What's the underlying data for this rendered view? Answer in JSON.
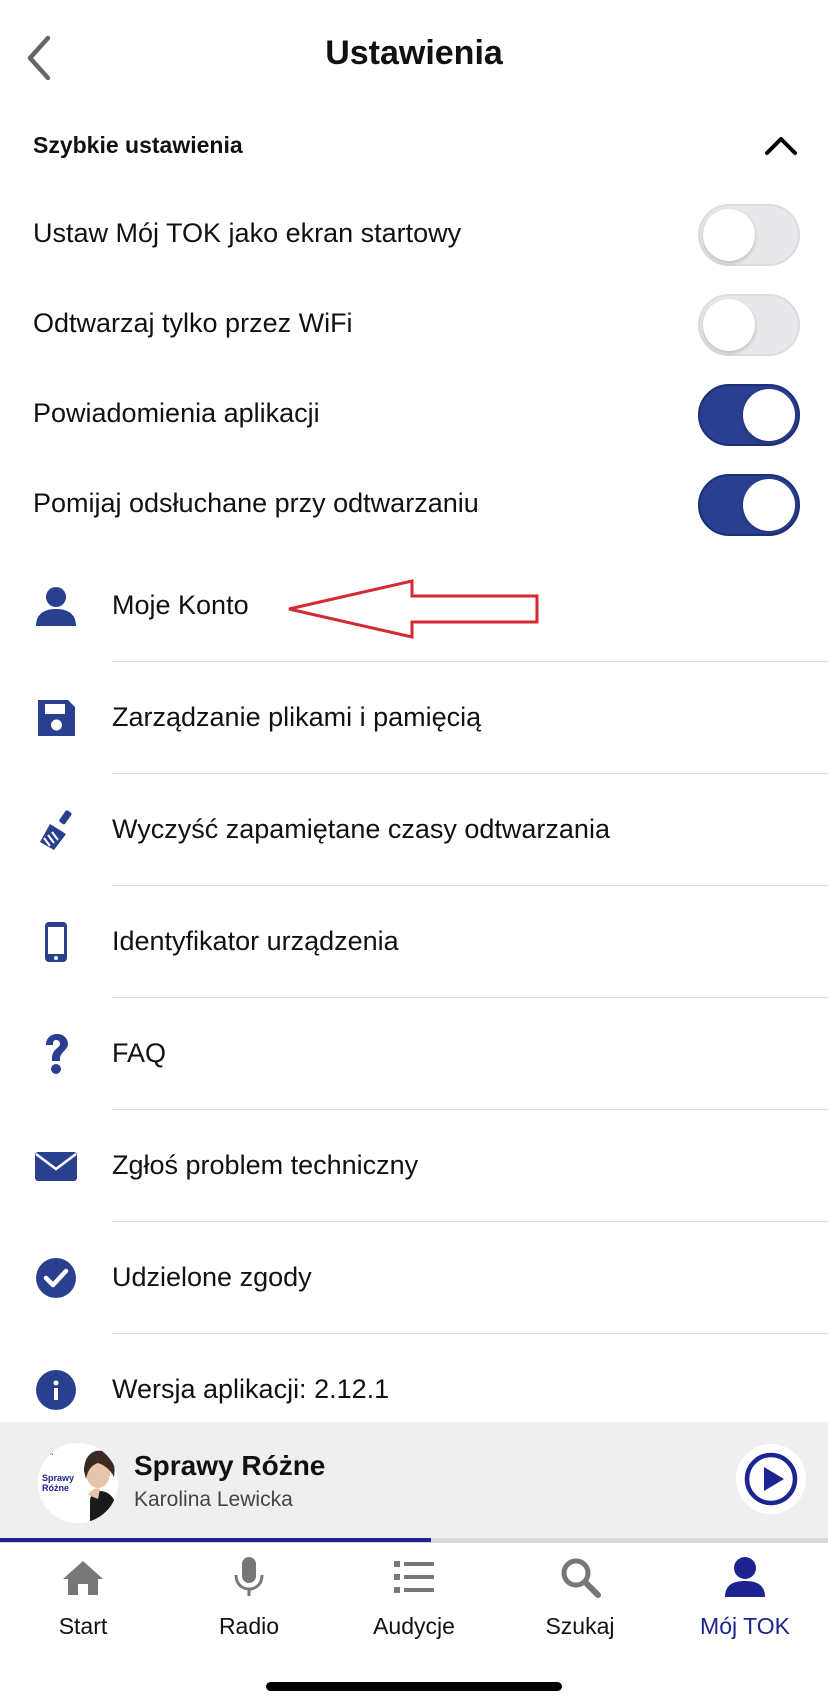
{
  "header": {
    "title": "Ustawienia"
  },
  "quick_settings": {
    "title": "Szybkie ustawienia",
    "toggles": [
      {
        "label": "Ustaw Mój TOK jako ekran startowy",
        "on": false
      },
      {
        "label": "Odtwarzaj tylko przez WiFi",
        "on": false
      },
      {
        "label": "Powiadomienia aplikacji",
        "on": true
      },
      {
        "label": "Pomijaj odsłuchane przy odtwarzaniu",
        "on": true
      }
    ]
  },
  "menu": [
    {
      "label": "Moje Konto",
      "icon": "user-icon"
    },
    {
      "label": "Zarządzanie plikami i pamięcią",
      "icon": "floppy-disk-icon"
    },
    {
      "label": "Wyczyść zapamiętane czasy odtwarzania",
      "icon": "brush-icon"
    },
    {
      "label": "Identyfikator urządzenia",
      "icon": "mobile-phone-icon"
    },
    {
      "label": "FAQ",
      "icon": "question-mark-icon"
    },
    {
      "label": "Zgłoś problem techniczny",
      "icon": "envelope-icon"
    },
    {
      "label": "Udzielone zgody",
      "icon": "check-circle-icon"
    },
    {
      "label": "Wersja aplikacji: 2.12.1",
      "icon": "info-circle-icon"
    }
  ],
  "player": {
    "title": "Sprawy Różne",
    "subtitle": "Karolina Lewicka",
    "cover_text": "Sprawy Różne",
    "progress": 0.52
  },
  "tabs": [
    {
      "label": "Start",
      "icon": "home-icon",
      "active": false
    },
    {
      "label": "Radio",
      "icon": "microphone-icon",
      "active": false
    },
    {
      "label": "Audycje",
      "icon": "list-icon",
      "active": false
    },
    {
      "label": "Szukaj",
      "icon": "search-icon",
      "active": false
    },
    {
      "label": "Mój TOK",
      "icon": "user-icon",
      "active": true
    }
  ],
  "colors": {
    "accent": "#2a3f8f",
    "tab_active": "#1d2390",
    "annotation": "#d42a35"
  }
}
